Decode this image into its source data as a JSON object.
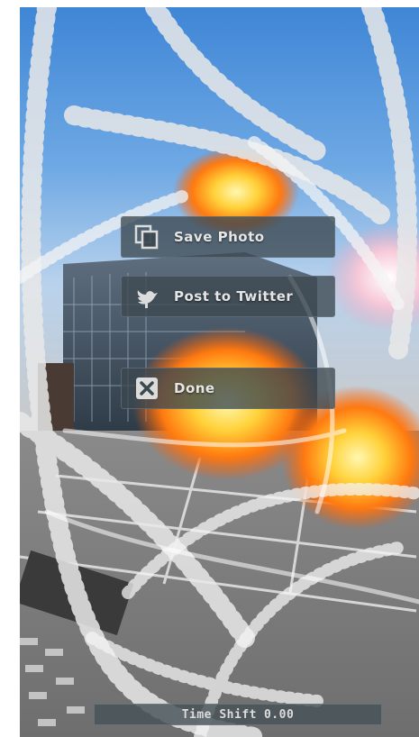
{
  "menu": {
    "save_photo": {
      "label": "Save Photo",
      "icon": "copy-photo-icon"
    },
    "post_twitter": {
      "label": "Post to Twitter",
      "icon": "twitter-bird-icon"
    },
    "done": {
      "label": "Done",
      "icon": "close-x-icon"
    }
  },
  "status": {
    "time_shift_label": "Time Shift",
    "time_shift_value": "0.00"
  },
  "colors": {
    "button_bg": "#3c4850",
    "button_text": "#e6e6e6",
    "sky": "#4a8ad6",
    "explosion": "#ff9a1e"
  }
}
